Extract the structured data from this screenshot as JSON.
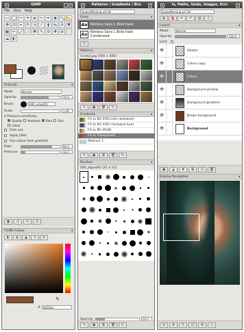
{
  "colors": {
    "fg": "#8a502a",
    "bg": "#ffffff",
    "accent": "#7a7a7a"
  },
  "toolbox": {
    "title": "GIMP",
    "menu": [
      "File",
      "Xtns",
      "Help"
    ],
    "tools": [
      "rect-select",
      "ellipse-select",
      "free-select",
      "fuzzy-select",
      "select-by-color",
      "scissors",
      "paths",
      "color-picker",
      "zoom",
      "measure",
      "move",
      "align",
      "crop",
      "rotate",
      "scale",
      "shear",
      "perspective",
      "flip",
      "text",
      "bucket-fill",
      "blend",
      "pencil",
      "paintbrush",
      "eraser",
      "airbrush",
      "ink",
      "clone",
      "heal",
      "perspective-clone",
      "blur",
      "smudge",
      "dodge-burn"
    ],
    "fg_hex": "#8a502a"
  },
  "airbrush": {
    "title": "Airbrush",
    "mode_label": "Mode:",
    "mode_value": "Normal",
    "opacity_label": "Opacity:",
    "opacity_value": "70.9",
    "opacity_fraction": 0.709,
    "brush_label": "Brush:",
    "brush_value": "000_adjust01",
    "scale_label": "Scale:",
    "scale_value": "1.00",
    "pressure_label": "Pressure sensitivity",
    "pressure_opts": [
      "Opacity",
      "Hardness",
      "Rate",
      "Size",
      "Colour"
    ],
    "fade_label": "Fade out",
    "jitter_label": "Apply Jitter",
    "gradient_label": "Use colour from gradient",
    "rate_label": "Rate:",
    "rate_value": "80.0",
    "pressure2_label": "Pressure:",
    "pressure2_value": "10.0"
  },
  "fgbg": {
    "title": "FG/BG Colour",
    "hex_value": "8a502a"
  },
  "fonts_win": {
    "title": "QueenMorning.xcf-18",
    "tabs_label": "Patterns | Gradients | Bru",
    "fonts_title": "Fonts",
    "fonts": [
      "Nimbus Sans L Bold Italic",
      "Nimbus Sans L Bold Italic Condensed"
    ],
    "patterns_title": "Patterns",
    "pattern_name": "Crack2.jpg (300 × 300)",
    "gradients_title": "Gradients",
    "gradients": [
      "FG to BG (HSV anti-clockwise)",
      "FG to BG (HSV clockwise hue)",
      "FG to BG (RGB)",
      "FG to Transparent",
      "Abstract 1"
    ],
    "gradients_selected": 3,
    "brushes_title": "Brushes",
    "brush_name": "000_adjust01 (21 × 21)",
    "spacing_label": "Spacing",
    "spacing_value": "20.0"
  },
  "layers_win": {
    "title": "QueenMorning.xcf-18",
    "tabs_label": "ls, Paths, Undo, Images, Errc",
    "layers_title": "Layers",
    "mode_label": "Mode:",
    "mode_value": "Normal",
    "opacity_label": "Opacity:",
    "opacity_value": "100.0",
    "lock_label": "Lock:",
    "layers": [
      "Palette",
      "Colour copy",
      "Colour",
      "Background window",
      "Background gradient",
      "Brown background",
      "Background"
    ],
    "selected_layer": 2,
    "nav_title": "Display Navigation"
  }
}
